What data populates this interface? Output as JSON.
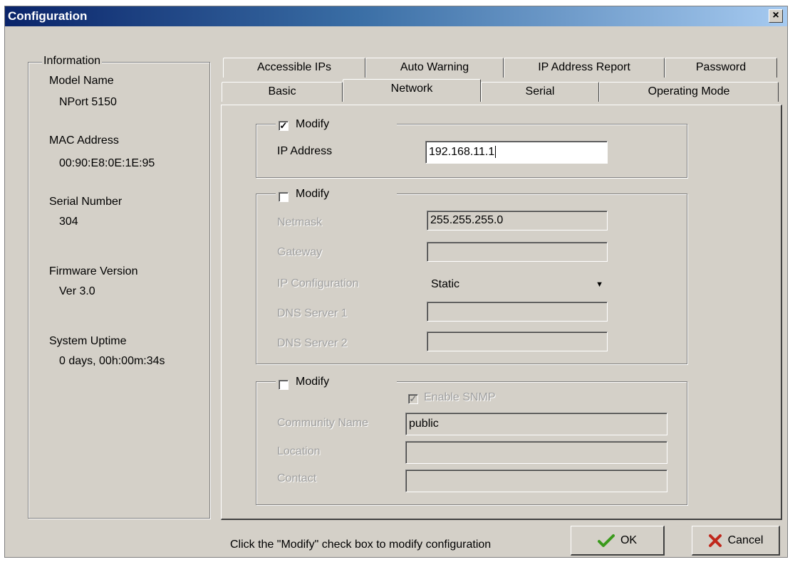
{
  "window": {
    "title": "Configuration",
    "close_glyph": "×"
  },
  "info": {
    "group_title": "Information",
    "items": [
      {
        "label": "Model Name",
        "value": "NPort 5150"
      },
      {
        "label": "MAC Address",
        "value": "00:90:E8:0E:1E:95"
      },
      {
        "label": "Serial Number",
        "value": "304"
      },
      {
        "label": "Firmware Version",
        "value": "Ver 3.0"
      },
      {
        "label": "System Uptime",
        "value": "0 days, 00h:00m:34s"
      }
    ]
  },
  "tabs": {
    "row1": [
      "Accessible IPs",
      "Auto Warning",
      "IP Address Report",
      "Password"
    ],
    "row2": [
      "Basic",
      "Network",
      "Serial",
      "Operating Mode"
    ],
    "active": "Network"
  },
  "network": {
    "ip_group": {
      "modify_label": "Modify",
      "modify_checked": true,
      "ip_label": "IP Address",
      "ip_value": "192.168.11.1"
    },
    "net_group": {
      "modify_label": "Modify",
      "modify_checked": false,
      "netmask_label": "Netmask",
      "netmask_value": "255.255.255.0",
      "gateway_label": "Gateway",
      "gateway_value": "",
      "ipconfig_label": "IP Configuration",
      "ipconfig_value": "Static",
      "dns1_label": "DNS Server 1",
      "dns1_value": "",
      "dns2_label": "DNS Server 2",
      "dns2_value": ""
    },
    "snmp_group": {
      "modify_label": "Modify",
      "modify_checked": false,
      "enable_snmp_label": "Enable SNMP",
      "enable_snmp_checked": true,
      "community_label": "Community Name",
      "community_value": "public",
      "location_label": "Location",
      "location_value": "",
      "contact_label": "Contact",
      "contact_value": ""
    }
  },
  "footer": {
    "hint": "Click the \"Modify\" check box to modify configuration",
    "ok_label": "OK",
    "cancel_label": "Cancel"
  },
  "icons": {
    "ok_icon": "check-icon",
    "cancel_icon": "x-icon",
    "dropdown_icon": "triangle-down-icon"
  },
  "colors": {
    "title_start": "#0a246a",
    "title_end": "#a6caf0",
    "ok_green": "#3a9a1c",
    "cancel_red": "#c0281c"
  }
}
